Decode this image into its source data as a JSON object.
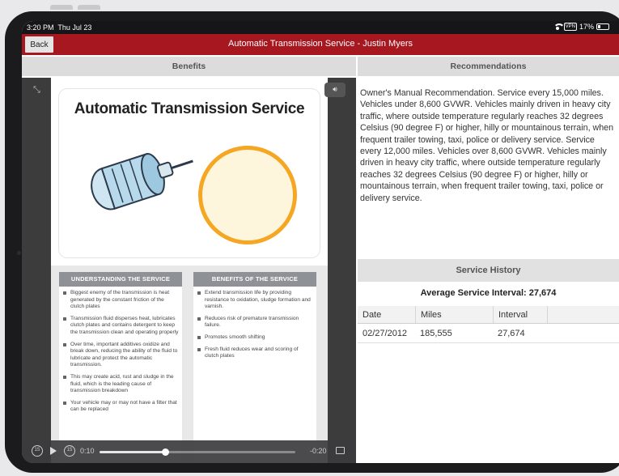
{
  "status_bar": {
    "time": "3:20 PM",
    "date": "Thu Jul 23",
    "vpn": "VPN",
    "battery": "17%"
  },
  "header": {
    "back_label": "Back",
    "title": "Automatic Transmission Service - Justin Myers",
    "accent_color": "#a6171f"
  },
  "columns": {
    "left_title": "Benefits",
    "right_title": "Recommendations"
  },
  "slide": {
    "title": "Automatic Transmission Service",
    "understanding": {
      "heading": "UNDERSTANDING THE SERVICE",
      "bullets": [
        "Biggest enemy of the transmission is heat generated by the constant friction of the clutch plates",
        "Transmission fluid disperses heat, lubricates clutch plates and contains detergent to keep the transmission clean and operating properly",
        "Over time, important additives oxidize and break down, reducing the ability of the fluid to lubricate and protect the automatic transmission.",
        "This may create acid, rust and sludge in the fluid, which is the leading cause of transmission breakdown",
        "Your vehicle may or may not have a filter that can be replaced"
      ]
    },
    "benefits": {
      "heading": "BENEFITS OF THE SERVICE",
      "bullets": [
        "Extend transmission life by providing resistance to oxidation, sludge formation and varnish.",
        "Reduces risk of premature transmission failure.",
        "Promotes smooth shifting",
        "Fresh fluid reduces wear and scoring of clutch plates"
      ]
    }
  },
  "player": {
    "rewind_label": "15",
    "forward_label": "15",
    "time_current": "0:10",
    "time_remaining": "-0:20",
    "progress": 0.333,
    "icons": [
      "expand-icon",
      "volume-icon",
      "rewind-icon",
      "play-icon",
      "forward-icon",
      "airplay-icon"
    ]
  },
  "recommendation": {
    "text": "Owner's Manual Recommendation. Service every 15,000 miles. Vehicles under 8,600 GVWR. Vehicles mainly driven in heavy city traffic, where outside temperature regularly reaches 32 degrees Celsius (90 degree F) or higher, hilly or mountainous terrain, when frequent trailer towing, taxi, police or delivery service. Service every 12,000 miles. Vehicles over 8,600 GVWR. Vehicles mainly driven in heavy city traffic, where outside temperature regularly reaches 32 degrees Celsius (90 degree F) or higher, hilly or mountainous terrain, when frequent trailer towing, taxi, police or delivery service."
  },
  "service_history": {
    "title": "Service History",
    "average_interval": "Average Service Interval: 27,674",
    "columns": [
      "Date",
      "Miles",
      "Interval",
      ""
    ],
    "rows": [
      {
        "date": "02/27/2012",
        "miles": "185,555",
        "interval": "27,674"
      }
    ]
  }
}
